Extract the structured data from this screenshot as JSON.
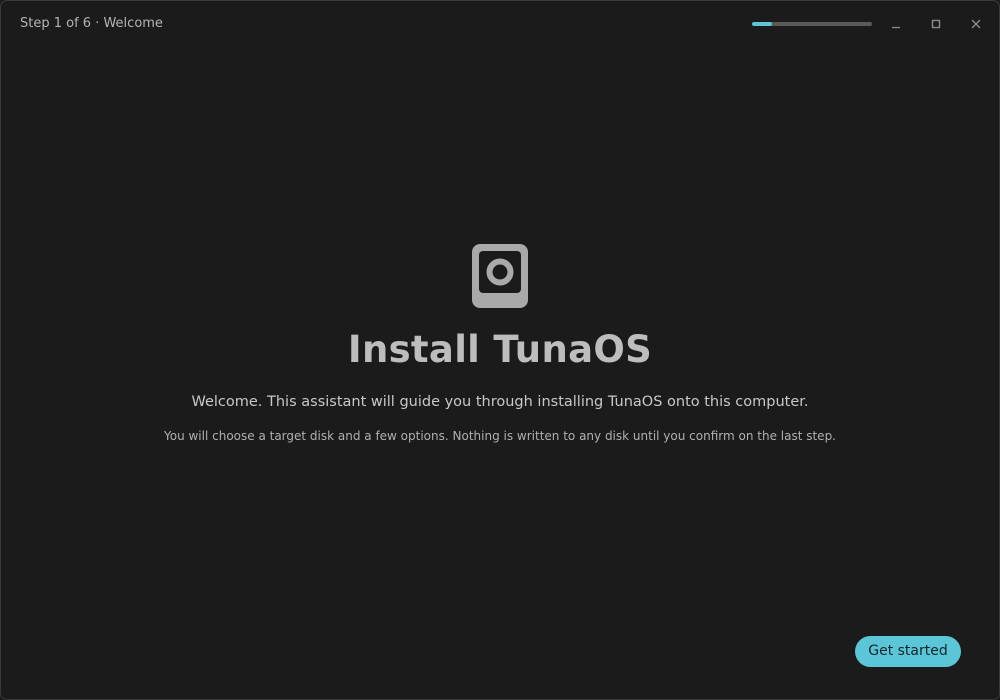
{
  "window": {
    "title": "Step 1 of 6 · Welcome",
    "progress": 0.1667,
    "accent_color": "#5bc6d8",
    "controls": {
      "minimize_icon": "minimize-icon",
      "maximize_icon": "maximize-icon",
      "close_icon": "close-icon"
    }
  },
  "welcome": {
    "icon": "disk-icon",
    "heading": "Install TunaOS",
    "lead": "Welcome. This assistant will guide you through installing TunaOS onto this computer.",
    "note": "You will choose a target disk and a few options. Nothing is written to any disk until you confirm on the last step."
  },
  "actions": {
    "primary_label": "Get started"
  }
}
